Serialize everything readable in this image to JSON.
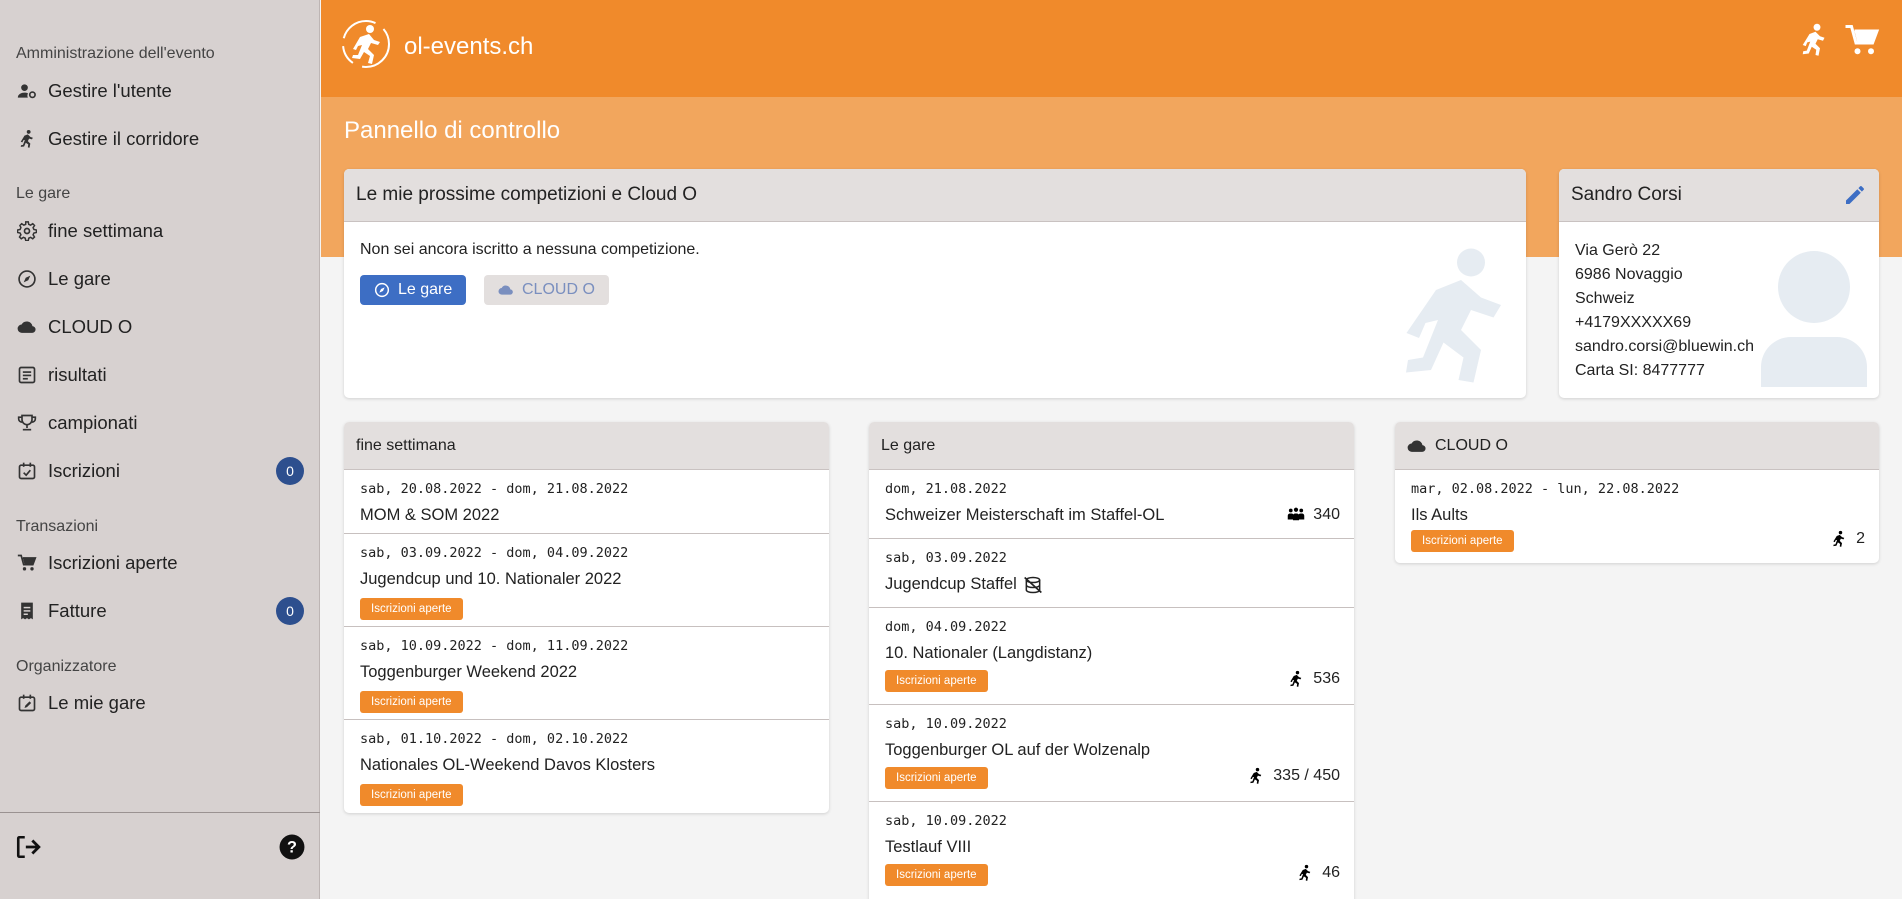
{
  "sidebar": {
    "groups": {
      "admin": "Amministrazione dell'evento",
      "races": "Le gare",
      "transactions": "Transazioni",
      "organizer": "Organizzatore"
    },
    "items": {
      "manage_user": "Gestire l'utente",
      "manage_runner": "Gestire il corridore",
      "weekend": "fine settimana",
      "races": "Le gare",
      "cloud": "CLOUD O",
      "results": "risultati",
      "championships": "campionati",
      "registrations": "Iscrizioni",
      "open_registrations": "Iscrizioni aperte",
      "invoices": "Fatture",
      "my_races": "Le mie gare"
    },
    "badges": {
      "registrations": "0",
      "invoices": "0"
    }
  },
  "header": {
    "brand": "ol-events.ch"
  },
  "page": {
    "title": "Pannello di controllo"
  },
  "upcoming": {
    "title": "Le mie prossime competizioni e Cloud O",
    "message": "Non sei ancora iscritto a nessuna competizione.",
    "btn_races": "Le gare",
    "btn_cloud": "CLOUD O"
  },
  "profile": {
    "name": "Sandro Corsi",
    "lines": [
      "Via Gerò 22",
      "6986 Novaggio",
      "Schweiz",
      "+4179XXXXX69",
      "sandro.corsi@bluewin.ch",
      "Carta SI: 8477777"
    ]
  },
  "tag_open": "Iscrizioni aperte",
  "weekend": {
    "title": "fine settimana",
    "rows": [
      {
        "date": "sab, 20.08.2022 - dom, 21.08.2022",
        "name": "MOM & SOM 2022"
      },
      {
        "date": "sab, 03.09.2022 - dom, 04.09.2022",
        "name": "Jugendcup und 10. Nationaler 2022"
      },
      {
        "date": "sab, 10.09.2022 - dom, 11.09.2022",
        "name": "Toggenburger Weekend 2022"
      },
      {
        "date": "sab, 01.10.2022 - dom, 02.10.2022",
        "name": "Nationales OL-Weekend Davos Klosters"
      }
    ]
  },
  "races": {
    "title": "Le gare",
    "rows": [
      {
        "date": "dom, 21.08.2022",
        "name": "Schweizer Meisterschaft im Staffel-OL",
        "count": "340"
      },
      {
        "date": "sab, 03.09.2022",
        "name": "Jugendcup Staffel"
      },
      {
        "date": "dom, 04.09.2022",
        "name": "10. Nationaler (Langdistanz)",
        "count": "536"
      },
      {
        "date": "sab, 10.09.2022",
        "name": "Toggenburger OL auf der Wolzenalp",
        "count": "335 / 450"
      },
      {
        "date": "sab, 10.09.2022",
        "name": "Testlauf VIII",
        "count": "46"
      }
    ]
  },
  "cloud": {
    "title": "CLOUD O",
    "rows": [
      {
        "date": "mar, 02.08.2022 - lun, 22.08.2022",
        "name": "Ils Aults",
        "count": "2"
      }
    ]
  },
  "colors": {
    "accent": "#f08a2b",
    "accent_light": "#f2a65d",
    "primary": "#3d6ec4",
    "badge": "#2d4f8e"
  }
}
